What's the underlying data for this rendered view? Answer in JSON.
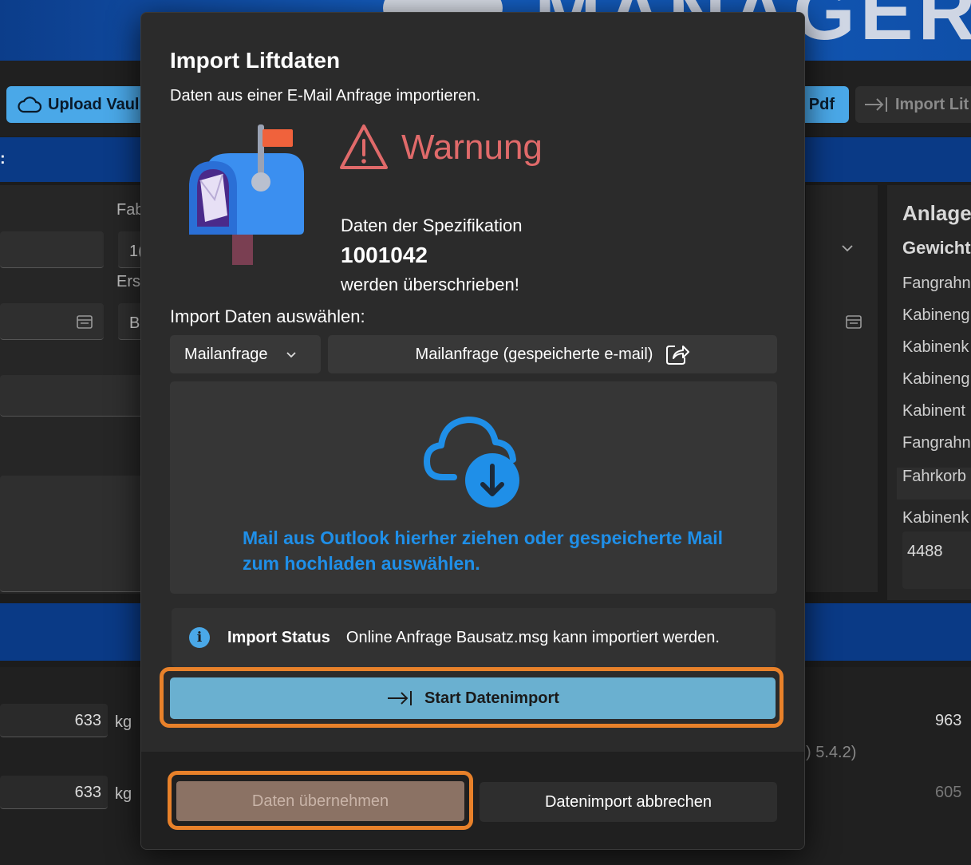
{
  "background": {
    "banner_word": "MANAGER",
    "toolbar": {
      "upload_label": "Upload Vaul",
      "pdf_label": "Pdf",
      "import_label": "Import Lit"
    },
    "section_colon": ":",
    "left_labels": [
      "Fab",
      "Ers"
    ],
    "left_values": [
      "1(",
      "B"
    ],
    "right_panel": {
      "title": "Anlage",
      "subtitle": "Gewicht",
      "items": [
        "Fangrahn",
        "Kabineng",
        "Kabinenk",
        "Kabineng",
        "Kabinent",
        "Fangrahn",
        "Fahrkorb",
        "Kabinenk"
      ],
      "value": "4488"
    },
    "lower": {
      "row1_value": "633",
      "row2_value": "633",
      "unit": "kg",
      "right_value1": "963",
      "right_note": ") 5.4.2)",
      "right_value2": "605"
    }
  },
  "dialog": {
    "title": "Import Liftdaten",
    "subtitle": "Daten aus einer E-Mail Anfrage importieren.",
    "warning": {
      "title": "Warnung",
      "line1": "Daten der Spezifikation",
      "spec_number": "1001042",
      "line3": "werden überschrieben!"
    },
    "select_label": "Import Daten auswählen:",
    "dropdown_value": "Mailanfrage",
    "saved_mail_button": "Mailanfrage (gespeicherte e-mail)",
    "dropzone_text": "Mail aus Outlook hierher ziehen oder gespeicherte Mail zum hochladen auswählen.",
    "status": {
      "label": "Import Status",
      "message": "Online Anfrage Bausatz.msg kann importiert werden."
    },
    "start_button": "Start Datenimport",
    "accept_button": "Daten übernehmen",
    "cancel_button": "Datenimport abbrechen"
  },
  "colors": {
    "accent": "#4aa8e8",
    "warning": "#e06a6a",
    "highlight": "#e8812a",
    "link": "#1f8fe8"
  }
}
